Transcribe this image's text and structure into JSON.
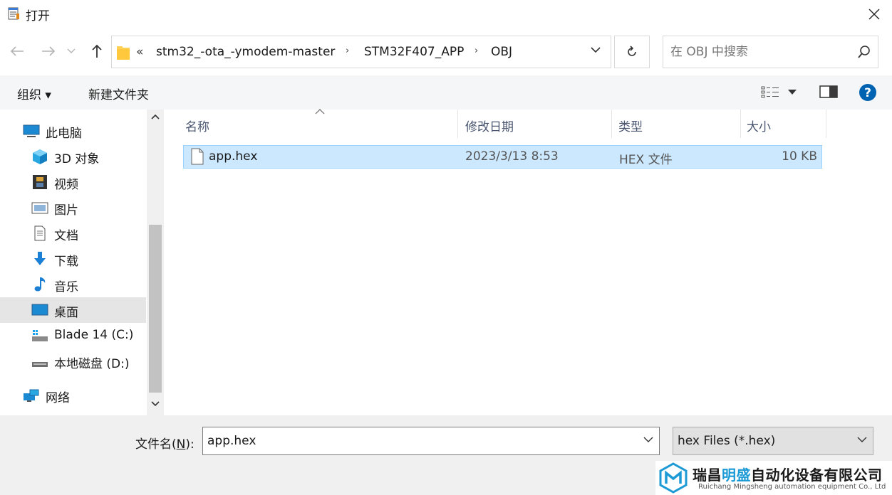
{
  "window": {
    "title": "打开"
  },
  "address": {
    "overflow": "«",
    "crumbs": [
      "stm32_-ota_-ymodem-master",
      "STM32F407_APP",
      "OBJ"
    ]
  },
  "search": {
    "placeholder": "在 OBJ 中搜索"
  },
  "toolbar": {
    "organize": "组织 ▾",
    "new_folder": "新建文件夹"
  },
  "sidebar": {
    "items": [
      {
        "label": "此电脑",
        "icon": "computer-icon"
      },
      {
        "label": "3D 对象",
        "icon": "cube-icon"
      },
      {
        "label": "视频",
        "icon": "film-icon"
      },
      {
        "label": "图片",
        "icon": "picture-icon"
      },
      {
        "label": "文档",
        "icon": "document-icon"
      },
      {
        "label": "下载",
        "icon": "download-arrow-icon"
      },
      {
        "label": "音乐",
        "icon": "music-note-icon"
      },
      {
        "label": "桌面",
        "icon": "desktop-icon"
      },
      {
        "label": "Blade 14 (C:)",
        "icon": "system-drive-icon"
      },
      {
        "label": "本地磁盘 (D:)",
        "icon": "drive-icon"
      },
      {
        "label": "网络",
        "icon": "network-icon"
      }
    ]
  },
  "columns": {
    "name": "名称",
    "modified": "修改日期",
    "type": "类型",
    "size": "大小"
  },
  "files": [
    {
      "name": "app.hex",
      "modified": "2023/3/13 8:53",
      "type": "HEX 文件",
      "size": "10 KB"
    }
  ],
  "filename": {
    "label_prefix": "文件名(",
    "label_key": "N",
    "label_suffix": "):",
    "value": "app.hex"
  },
  "filetype": {
    "selected": "hex Files (*.hex)"
  },
  "watermark": {
    "cn_a": "瑞昌",
    "cn_b": "明盛",
    "cn_c": "自动化设备有限公司",
    "en": "Ruichang Mingsheng automation equipment Co., Ltd"
  },
  "colors": {
    "selection": "#cce8ff",
    "selection_border": "#99d1ff",
    "help": "#0063b1",
    "accent": "#1c9ad6"
  }
}
